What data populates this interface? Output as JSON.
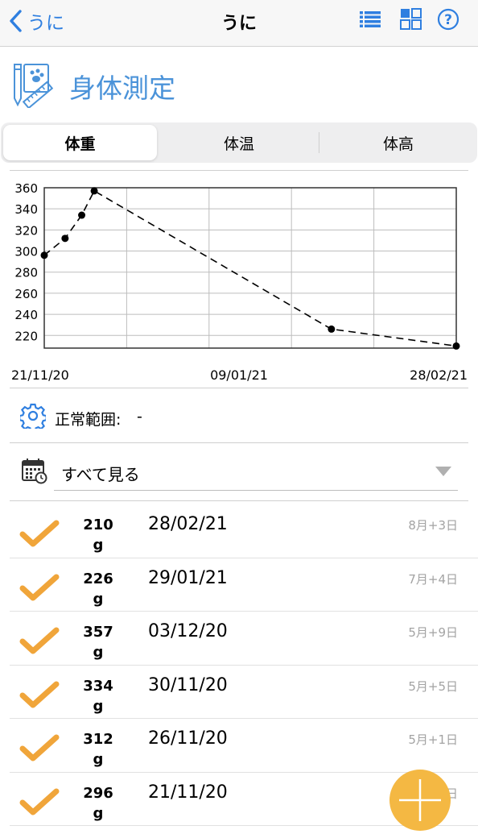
{
  "nav": {
    "back_label": "うに",
    "title": "うに"
  },
  "header": {
    "title": "身体測定"
  },
  "tabs": [
    {
      "label": "体重",
      "active": true
    },
    {
      "label": "体温",
      "active": false
    },
    {
      "label": "体高",
      "active": false
    }
  ],
  "chart_data": {
    "type": "line",
    "x": [
      "21/11/20",
      "26/11/20",
      "30/11/20",
      "03/12/20",
      "29/01/21",
      "28/02/21"
    ],
    "values": [
      296,
      312,
      334,
      357,
      226,
      210
    ],
    "yticks": [
      220,
      240,
      260,
      280,
      300,
      320,
      340,
      360
    ],
    "ylim": [
      208,
      360
    ],
    "xlim": [
      "21/11/20",
      "28/02/21"
    ],
    "xtick_labels": [
      "21/11/20",
      "09/01/21",
      "28/02/21"
    ],
    "grid": true,
    "line_style": "dashed",
    "color": "#000000"
  },
  "normal_range": {
    "label": "正常範囲:",
    "value": "-"
  },
  "filter": {
    "label": "すべて見る"
  },
  "records": [
    {
      "value": "210",
      "unit": "g",
      "date": "28/02/21",
      "age": "8月+3日"
    },
    {
      "value": "226",
      "unit": "g",
      "date": "29/01/21",
      "age": "7月+4日"
    },
    {
      "value": "357",
      "unit": "g",
      "date": "03/12/20",
      "age": "5月+9日"
    },
    {
      "value": "334",
      "unit": "g",
      "date": "30/11/20",
      "age": "5月+5日"
    },
    {
      "value": "312",
      "unit": "g",
      "date": "26/11/20",
      "age": "5月+1日"
    },
    {
      "value": "296",
      "unit": "g",
      "date": "21/11/20",
      "age": "日"
    }
  ],
  "colors": {
    "accent_blue": "#2f7fe0",
    "header_blue": "#4b93d9",
    "check_orange": "#f0a53a",
    "fab_orange": "#f4b843"
  },
  "icons": {
    "back": "chevron-left-icon",
    "list": "list-icon",
    "grid": "grid-icon",
    "help": "help-icon",
    "measure": "measure-notebook-icon",
    "gear": "gear-icon",
    "calendar": "calendar-icon",
    "check": "checkmark-icon",
    "add": "plus-icon"
  }
}
